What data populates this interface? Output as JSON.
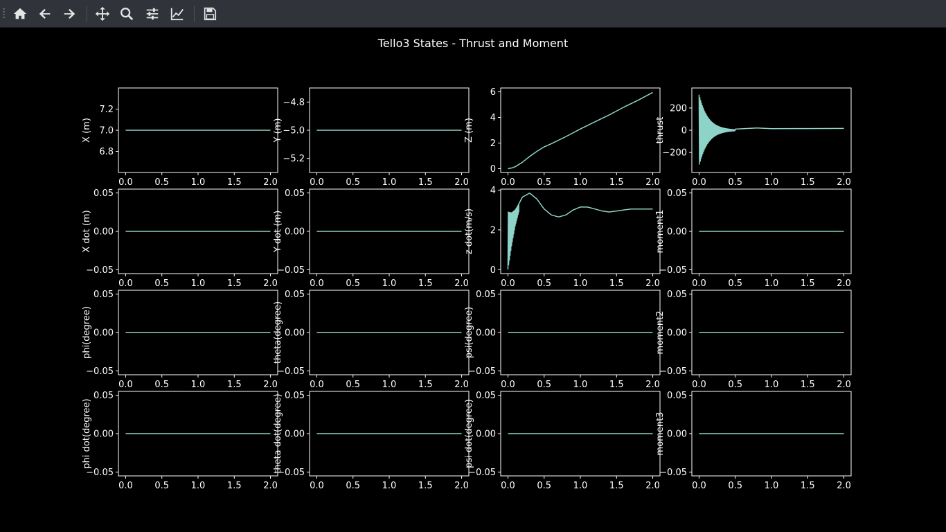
{
  "toolbar": {
    "buttons": [
      {
        "name": "home-button",
        "icon": "home-icon"
      },
      {
        "name": "back-button",
        "icon": "arrow-left-icon"
      },
      {
        "name": "forward-button",
        "icon": "arrow-right-icon"
      },
      {
        "name": "pan-button",
        "icon": "move-icon"
      },
      {
        "name": "zoom-button",
        "icon": "magnifier-icon"
      },
      {
        "name": "configure-subplots-button",
        "icon": "sliders-icon"
      },
      {
        "name": "edit-axes-button",
        "icon": "line-chart-icon"
      },
      {
        "name": "save-button",
        "icon": "floppy-disk-icon"
      }
    ]
  },
  "figure": {
    "title": "Tello3 States - Thrust and Moment",
    "background": "#000000",
    "line_color": "#8dd3c7",
    "text_color": "#ffffff"
  },
  "chart_data": [
    {
      "id": "x",
      "type": "line",
      "ylabel": "X (m)",
      "xlim": [
        -0.1,
        2.1
      ],
      "ylim": [
        6.6,
        7.4
      ],
      "xticks": [
        "0.0",
        "0.5",
        "1.0",
        "1.5",
        "2.0"
      ],
      "yticks": [
        {
          "v": 6.8,
          "label": "6.8"
        },
        {
          "v": 7.0,
          "label": "7.0"
        },
        {
          "v": 7.2,
          "label": "7.2"
        }
      ],
      "series": [
        {
          "kind": "const",
          "value": 7.0
        }
      ]
    },
    {
      "id": "y",
      "type": "line",
      "ylabel": "Y (m)",
      "xlim": [
        -0.1,
        2.1
      ],
      "ylim": [
        -5.3,
        -4.7
      ],
      "xticks": [
        "0.0",
        "0.5",
        "1.0",
        "1.5",
        "2.0"
      ],
      "yticks": [
        {
          "v": -5.2,
          "label": "−5.2"
        },
        {
          "v": -5.0,
          "label": "−5.0"
        },
        {
          "v": -4.8,
          "label": "−4.8"
        }
      ],
      "series": [
        {
          "kind": "const",
          "value": -5.0
        }
      ]
    },
    {
      "id": "z",
      "type": "line",
      "ylabel": "Z (m)",
      "xlim": [
        -0.1,
        2.1
      ],
      "ylim": [
        -0.3,
        6.3
      ],
      "xticks": [
        "0.0",
        "0.5",
        "1.0",
        "1.5",
        "2.0"
      ],
      "yticks": [
        {
          "v": 0,
          "label": "0"
        },
        {
          "v": 2,
          "label": "2"
        },
        {
          "v": 4,
          "label": "4"
        },
        {
          "v": 6,
          "label": "6"
        }
      ],
      "series": [
        {
          "x": [
            0,
            0.05,
            0.1,
            0.2,
            0.3,
            0.4,
            0.5,
            0.6,
            0.8,
            1.0,
            1.2,
            1.4,
            1.6,
            1.8,
            2.0
          ],
          "y": [
            0,
            0.05,
            0.15,
            0.5,
            0.95,
            1.35,
            1.7,
            1.95,
            2.5,
            3.1,
            3.65,
            4.2,
            4.8,
            5.35,
            5.95
          ]
        }
      ]
    },
    {
      "id": "thrust",
      "type": "line",
      "ylabel": "thrust",
      "xlim": [
        -0.1,
        2.1
      ],
      "ylim": [
        -380,
        380
      ],
      "xticks": [
        "0.0",
        "0.5",
        "1.0",
        "1.5",
        "2.0"
      ],
      "yticks": [
        {
          "v": -200,
          "label": "−200"
        },
        {
          "v": 0,
          "label": "0"
        },
        {
          "v": 200,
          "label": "200"
        }
      ],
      "series": [
        {
          "kind": "decay-osc",
          "amp": 320,
          "tau": 0.12,
          "t_end": 0.5,
          "settle": [
            {
              "x": 0.5,
              "y": 10
            },
            {
              "x": 0.8,
              "y": 20
            },
            {
              "x": 1.0,
              "y": 14
            },
            {
              "x": 1.5,
              "y": 15
            },
            {
              "x": 2.0,
              "y": 16
            }
          ]
        }
      ]
    },
    {
      "id": "xdot",
      "type": "line",
      "ylabel": "X dot (m)",
      "xlim": [
        -0.1,
        2.1
      ],
      "ylim": [
        -0.055,
        0.055
      ],
      "xticks": [
        "0.0",
        "0.5",
        "1.0",
        "1.5",
        "2.0"
      ],
      "yticks": [
        {
          "v": -0.05,
          "label": "−0.05"
        },
        {
          "v": 0,
          "label": "0.00"
        },
        {
          "v": 0.05,
          "label": "0.05"
        }
      ],
      "series": [
        {
          "kind": "const",
          "value": 0
        }
      ]
    },
    {
      "id": "ydot",
      "type": "line",
      "ylabel": "Y dot (m)",
      "xlim": [
        -0.1,
        2.1
      ],
      "ylim": [
        -0.055,
        0.055
      ],
      "xticks": [
        "0.0",
        "0.5",
        "1.0",
        "1.5",
        "2.0"
      ],
      "yticks": [
        {
          "v": -0.05,
          "label": "−0.05"
        },
        {
          "v": 0,
          "label": "0.00"
        },
        {
          "v": 0.05,
          "label": "0.05"
        }
      ],
      "series": [
        {
          "kind": "const",
          "value": 0
        }
      ]
    },
    {
      "id": "zdot",
      "type": "line",
      "ylabel": "z dot(m/s)",
      "xlim": [
        -0.1,
        2.1
      ],
      "ylim": [
        -0.2,
        4.05
      ],
      "xticks": [
        "0.0",
        "0.5",
        "1.0",
        "1.5",
        "2.0"
      ],
      "yticks": [
        {
          "v": 0,
          "label": "0"
        },
        {
          "v": 2,
          "label": "2"
        },
        {
          "v": 4,
          "label": "4"
        }
      ],
      "series": [
        {
          "kind": "osc-band",
          "band": [
            {
              "x": 0,
              "lo": 0,
              "hi": 2.9
            },
            {
              "x": 0.05,
              "lo": 1.2,
              "hi": 2.85
            },
            {
              "x": 0.1,
              "lo": 2.2,
              "hi": 3.0
            },
            {
              "x": 0.15,
              "lo": 2.9,
              "hi": 3.3
            }
          ],
          "x": [
            0.15,
            0.2,
            0.3,
            0.4,
            0.5,
            0.6,
            0.7,
            0.8,
            0.9,
            1.0,
            1.1,
            1.2,
            1.3,
            1.4,
            1.5,
            1.6,
            1.7,
            1.8,
            1.9,
            2.0
          ],
          "y": [
            3.3,
            3.65,
            3.85,
            3.55,
            3.05,
            2.75,
            2.65,
            2.75,
            3.0,
            3.15,
            3.15,
            3.05,
            2.95,
            2.9,
            2.95,
            3.0,
            3.05,
            3.05,
            3.05,
            3.05
          ]
        }
      ]
    },
    {
      "id": "moment1",
      "type": "line",
      "ylabel": "moment1",
      "xlim": [
        -0.1,
        2.1
      ],
      "ylim": [
        -0.055,
        0.055
      ],
      "xticks": [
        "0.0",
        "0.5",
        "1.0",
        "1.5",
        "2.0"
      ],
      "yticks": [
        {
          "v": -0.05,
          "label": "−0.05"
        },
        {
          "v": 0,
          "label": "0.00"
        },
        {
          "v": 0.05,
          "label": "0.05"
        }
      ],
      "series": [
        {
          "kind": "const",
          "value": 0
        }
      ]
    },
    {
      "id": "phi",
      "type": "line",
      "ylabel": "phi(degree)",
      "xlim": [
        -0.1,
        2.1
      ],
      "ylim": [
        -0.055,
        0.055
      ],
      "xticks": [
        "0.0",
        "0.5",
        "1.0",
        "1.5",
        "2.0"
      ],
      "yticks": [
        {
          "v": -0.05,
          "label": "−0.05"
        },
        {
          "v": 0,
          "label": "0.00"
        },
        {
          "v": 0.05,
          "label": "0.05"
        }
      ],
      "series": [
        {
          "kind": "const",
          "value": 0
        }
      ]
    },
    {
      "id": "theta",
      "type": "line",
      "ylabel": "theta(degree)",
      "xlim": [
        -0.1,
        2.1
      ],
      "ylim": [
        -0.055,
        0.055
      ],
      "xticks": [
        "0.0",
        "0.5",
        "1.0",
        "1.5",
        "2.0"
      ],
      "yticks": [
        {
          "v": -0.05,
          "label": "−0.05"
        },
        {
          "v": 0,
          "label": "0.00"
        },
        {
          "v": 0.05,
          "label": "0.05"
        }
      ],
      "series": [
        {
          "kind": "const",
          "value": 0
        }
      ]
    },
    {
      "id": "psi",
      "type": "line",
      "ylabel": "psi(degree)",
      "xlim": [
        -0.1,
        2.1
      ],
      "ylim": [
        -0.055,
        0.055
      ],
      "xticks": [
        "0.0",
        "0.5",
        "1.0",
        "1.5",
        "2.0"
      ],
      "yticks": [
        {
          "v": -0.05,
          "label": "−0.05"
        },
        {
          "v": 0,
          "label": "0.00"
        },
        {
          "v": 0.05,
          "label": "0.05"
        }
      ],
      "series": [
        {
          "kind": "const",
          "value": 0
        }
      ]
    },
    {
      "id": "moment2",
      "type": "line",
      "ylabel": "moment2",
      "xlim": [
        -0.1,
        2.1
      ],
      "ylim": [
        -0.055,
        0.055
      ],
      "xticks": [
        "0.0",
        "0.5",
        "1.0",
        "1.5",
        "2.0"
      ],
      "yticks": [
        {
          "v": -0.05,
          "label": "−0.05"
        },
        {
          "v": 0,
          "label": "0.00"
        },
        {
          "v": 0.05,
          "label": "0.05"
        }
      ],
      "series": [
        {
          "kind": "const",
          "value": 0
        }
      ]
    },
    {
      "id": "phidot",
      "type": "line",
      "ylabel": "phi dot(degree)",
      "xlim": [
        -0.1,
        2.1
      ],
      "ylim": [
        -0.055,
        0.055
      ],
      "xticks": [
        "0.0",
        "0.5",
        "1.0",
        "1.5",
        "2.0"
      ],
      "yticks": [
        {
          "v": -0.05,
          "label": "−0.05"
        },
        {
          "v": 0,
          "label": "0.00"
        },
        {
          "v": 0.05,
          "label": "0.05"
        }
      ],
      "series": [
        {
          "kind": "const",
          "value": 0
        }
      ]
    },
    {
      "id": "thetadot",
      "type": "line",
      "ylabel": "theta dot(degree)",
      "xlim": [
        -0.1,
        2.1
      ],
      "ylim": [
        -0.055,
        0.055
      ],
      "xticks": [
        "0.0",
        "0.5",
        "1.0",
        "1.5",
        "2.0"
      ],
      "yticks": [
        {
          "v": -0.05,
          "label": "−0.05"
        },
        {
          "v": 0,
          "label": "0.00"
        },
        {
          "v": 0.05,
          "label": "0.05"
        }
      ],
      "series": [
        {
          "kind": "const",
          "value": 0
        }
      ]
    },
    {
      "id": "psidot",
      "type": "line",
      "ylabel": "psi dot(degree)",
      "xlim": [
        -0.1,
        2.1
      ],
      "ylim": [
        -0.055,
        0.055
      ],
      "xticks": [
        "0.0",
        "0.5",
        "1.0",
        "1.5",
        "2.0"
      ],
      "yticks": [
        {
          "v": -0.05,
          "label": "−0.05"
        },
        {
          "v": 0,
          "label": "0.00"
        },
        {
          "v": 0.05,
          "label": "0.05"
        }
      ],
      "series": [
        {
          "kind": "const",
          "value": 0
        }
      ]
    },
    {
      "id": "moment3",
      "type": "line",
      "ylabel": "moment3",
      "xlim": [
        -0.1,
        2.1
      ],
      "ylim": [
        -0.055,
        0.055
      ],
      "xticks": [
        "0.0",
        "0.5",
        "1.0",
        "1.5",
        "2.0"
      ],
      "yticks": [
        {
          "v": -0.05,
          "label": "−0.05"
        },
        {
          "v": 0,
          "label": "0.00"
        },
        {
          "v": 0.05,
          "label": "0.05"
        }
      ],
      "series": [
        {
          "kind": "const",
          "value": 0
        }
      ]
    }
  ]
}
